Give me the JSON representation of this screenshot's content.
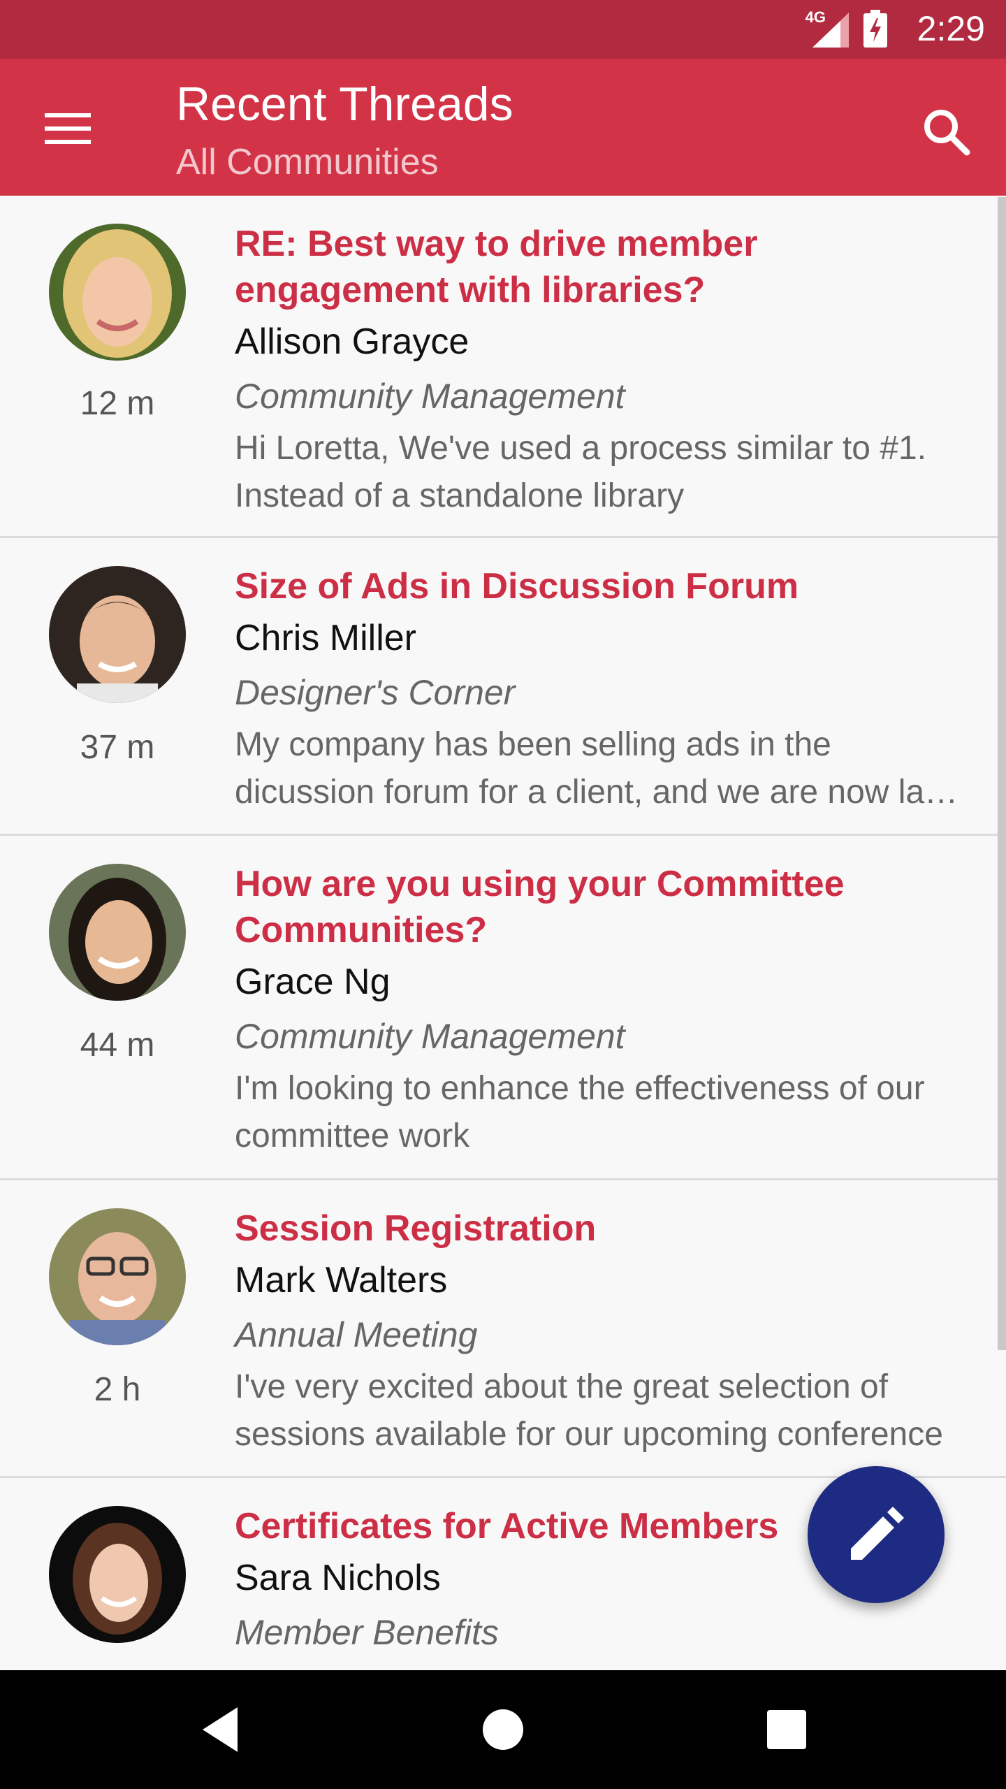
{
  "status_bar": {
    "network": "4G",
    "time": "2:29",
    "icons": [
      "signal-icon",
      "battery-charging-icon"
    ]
  },
  "app_bar": {
    "title": "Recent Threads",
    "subtitle": "All Communities",
    "menu_icon": "hamburger-menu-icon",
    "search_icon": "search-icon"
  },
  "threads": [
    {
      "title": "RE: Best way to drive member engagement with libraries?",
      "author": "Allison Grayce",
      "community": "Community Management",
      "preview": "Hi Loretta, We've used a process similar to #1.\nInstead of a standalone library",
      "time": "12 m"
    },
    {
      "title": "Size of Ads in Discussion Forum",
      "author": "Chris Miller",
      "community": "Designer's Corner",
      "preview": "My company has been selling ads in the\ndicussion forum for a client, and we are now la…",
      "time": "37 m"
    },
    {
      "title": "How are you using your Committee Communities?",
      "author": "Grace Ng",
      "community": "Community Management",
      "preview": "I'm looking to enhance the effectiveness of our\ncommittee work",
      "time": "44 m"
    },
    {
      "title": "Session Registration",
      "author": "Mark Walters",
      "community": "Annual Meeting",
      "preview": "I've very excited about the great selection of\nsessions available for our upcoming conference",
      "time": "2 h"
    },
    {
      "title": "Certificates for Active Members",
      "author": "Sara Nichols",
      "community": "Member Benefits",
      "preview": "",
      "time": ""
    }
  ],
  "fab": {
    "icon": "pencil-edit-icon"
  },
  "nav_bar": {
    "icons": [
      "back-icon",
      "home-icon",
      "recents-icon"
    ]
  },
  "colors": {
    "status_bar": "#b22a3f",
    "app_bar": "#d33347",
    "thread_title": "#cc2f45",
    "fab": "#1e2b83",
    "background": "#f8f8f9"
  }
}
